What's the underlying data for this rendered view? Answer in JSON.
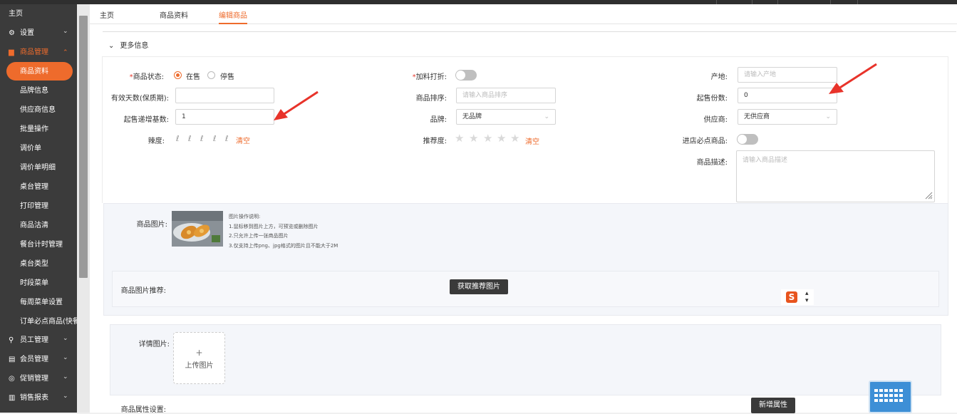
{
  "sidebar": {
    "home": "主页",
    "settings": "设置",
    "goods_mgmt": "商品管理",
    "sub_items": [
      "商品资料",
      "品牌信息",
      "供应商信息",
      "批量操作",
      "调价单",
      "调价单明细",
      "桌台管理",
      "打印管理",
      "商品沽清",
      "餐台计时管理",
      "桌台类型",
      "时段菜单",
      "每周菜单设置",
      "订单必点商品(快餐)"
    ],
    "staff": "员工管理",
    "member": "会员管理",
    "promo": "促销管理",
    "sales": "销售报表"
  },
  "tabs": [
    "主页",
    "商品资料",
    "编辑商品"
  ],
  "section_title": "更多信息",
  "form": {
    "status_label": "商品状态:",
    "status_on": "在售",
    "status_off": "停售",
    "shelf_label": "有效天数(保质期):",
    "shelf_value": "",
    "increment_label": "起售递增基数:",
    "increment_value": "1",
    "spicy_label": "辣度:",
    "clear": "清空",
    "addon_label": "加料打折:",
    "sort_label": "商品排序:",
    "sort_placeholder": "请输入商品排序",
    "brand_label": "品牌:",
    "brand_value": "无品牌",
    "recommend_label": "推荐度:",
    "origin_label": "产地:",
    "origin_placeholder": "请输入产地",
    "min_qty_label": "起售份数:",
    "min_qty_value": "0",
    "supplier_label": "供应商:",
    "supplier_value": "无供应商",
    "must_label": "进店必点商品:",
    "desc_label": "商品描述:",
    "desc_placeholder": "请输入商品描述"
  },
  "image": {
    "label": "商品图片:",
    "notes_title": "图片操作说明:",
    "notes": [
      "1.鼠标移到图片上方，可预览或删除图片",
      "2.只允许上传一张商品图片",
      "3.仅支持上传png、jpg格式的图片且不能大于2M"
    ],
    "recommend_label": "商品图片推荐:",
    "recommend_button": "获取推荐图片"
  },
  "detail": {
    "label": "详情图片:",
    "upload_plus": "+",
    "upload_text": "上传图片"
  },
  "attr": {
    "label": "商品属性设置:",
    "add_button": "新增属性"
  },
  "colors": {
    "accent": "#ee6b2c",
    "sidebar": "#3b3b3b",
    "arrow": "#e8332a"
  }
}
